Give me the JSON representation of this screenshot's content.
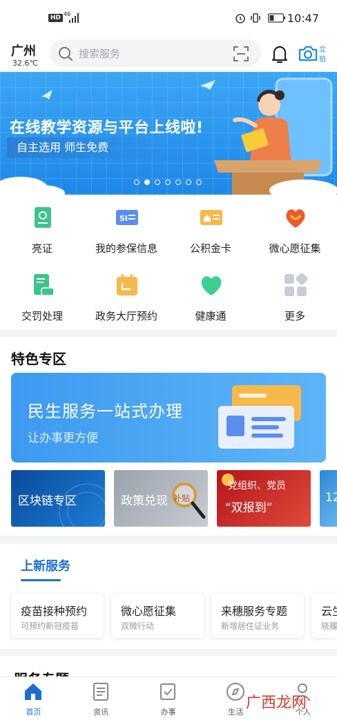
{
  "status_bar": {
    "hd": "HD",
    "network": "46",
    "time": "10:47"
  },
  "header": {
    "city": "广州",
    "temperature": "32.6℃",
    "search_placeholder": "搜索服务",
    "camera_label_top": "立",
    "camera_label_bottom": "拍"
  },
  "banner": {
    "headline": "在线教学资源与平台上线啦!",
    "tagline": "自主选用 师生免费",
    "dot_count": 7,
    "active_dot": 1
  },
  "services": [
    {
      "label": "亮证",
      "icon": "id-card-icon",
      "color": "#3cc48b"
    },
    {
      "label": "我的参保信息",
      "icon": "social-insurance-icon",
      "color": "#5c8ef0"
    },
    {
      "label": "公积金卡",
      "icon": "housing-fund-card-icon",
      "color": "#f6b84b"
    },
    {
      "label": "微心愿征集",
      "icon": "heart-hands-icon",
      "color": "#ee5a2c"
    },
    {
      "label": "交罚处理",
      "icon": "traffic-ticket-icon",
      "color": "#3cc48b"
    },
    {
      "label": "政务大厅预约",
      "icon": "calendar-icon",
      "color": "#f6b84b"
    },
    {
      "label": "健康通",
      "icon": "health-heart-icon",
      "color": "#3ccf8e"
    },
    {
      "label": "更多",
      "icon": "more-grid-icon",
      "color": "#c9ced6"
    }
  ],
  "featured": {
    "title": "特色专区",
    "main_card": {
      "title": "民生服务一站式办理",
      "subtitle": "让办事更方便"
    },
    "tiles": [
      {
        "label": "区块链专区"
      },
      {
        "label": "政策兑现",
        "badge": "补贴"
      },
      {
        "label": "党组织、党员",
        "label2": "“双报到”"
      },
      {
        "label": "12"
      }
    ]
  },
  "new_services": {
    "title": "上新服务",
    "cards": [
      {
        "title": "疫苗接种预约",
        "desc": "可预约新冠疫苗"
      },
      {
        "title": "微心愿征集",
        "desc": "双微行动"
      },
      {
        "title": "来穗服务专题",
        "desc": "新增居住证业务"
      },
      {
        "title": "云生",
        "desc": "晓履"
      }
    ]
  },
  "next_section": {
    "title": "服务专题"
  },
  "tabbar": [
    {
      "label": "首页",
      "icon": "home-icon",
      "active": true
    },
    {
      "label": "资讯",
      "icon": "news-icon",
      "active": false
    },
    {
      "label": "办事",
      "icon": "tasks-icon",
      "active": false
    },
    {
      "label": "生活",
      "icon": "compass-icon",
      "active": false
    },
    {
      "label": "个人",
      "icon": "person-icon",
      "active": false
    }
  ],
  "watermark": "广西龙网"
}
